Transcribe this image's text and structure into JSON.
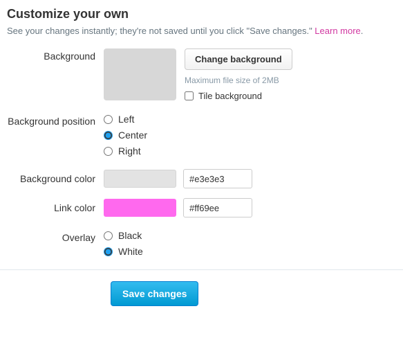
{
  "header": {
    "title": "Customize your own",
    "subtext_prefix": "See your changes instantly; they're not saved until you click \"Save changes.\" ",
    "learn_more": "Learn more"
  },
  "labels": {
    "background": "Background",
    "background_position": "Background position",
    "background_color": "Background color",
    "link_color": "Link color",
    "overlay": "Overlay"
  },
  "background": {
    "change_button": "Change background",
    "hint": "Maximum file size of 2MB",
    "tile_label": "Tile background",
    "tile_checked": false
  },
  "position": {
    "options": [
      "Left",
      "Center",
      "Right"
    ],
    "selected": "Center"
  },
  "bg_color": {
    "hex": "#e3e3e3"
  },
  "link_color": {
    "hex": "#ff69ee"
  },
  "overlay": {
    "options": [
      "Black",
      "White"
    ],
    "selected": "White"
  },
  "footer": {
    "save": "Save changes"
  }
}
